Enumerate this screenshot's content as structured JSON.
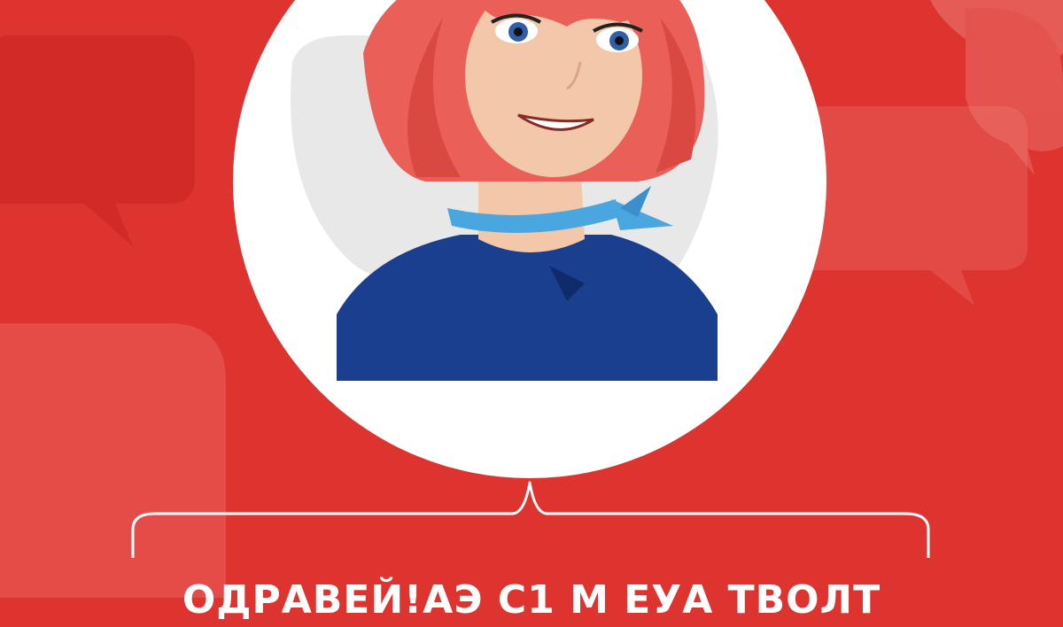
{
  "colors": {
    "background": "#dd3430",
    "bubble": "#e86a60",
    "hair": "#ea5f57",
    "skin": "#f2c7aa",
    "scarf": "#4aa6de",
    "top": "#1b3f8f",
    "avatar_circle": "#ffffff"
  },
  "illustration": {
    "subject": "cartoon woman with red bob hair, blue scarf and blue top",
    "icons": [
      "speech-bubble-icon",
      "speech-bubble-icon",
      "speech-bubble-icon",
      "speech-bubble-icon"
    ]
  },
  "banner": {
    "headline": "ОДРАВЕЙ!АЭ С1 М ЕУА ТВОЛТ"
  }
}
